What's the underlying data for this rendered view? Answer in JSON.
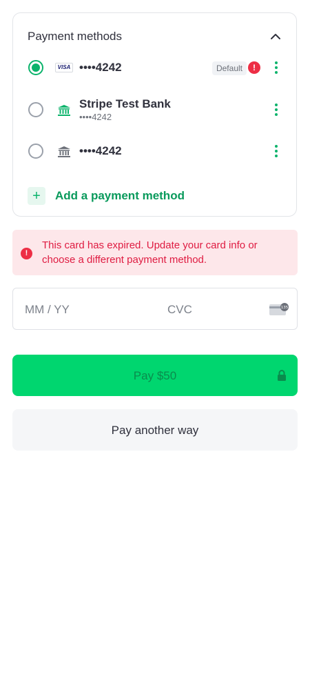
{
  "payment_methods": {
    "header": "Payment methods",
    "items": [
      {
        "brand": "VISA",
        "title": "••••4242",
        "selected": true,
        "badge": "Default",
        "error_icon": "!"
      },
      {
        "title": "Stripe Test Bank",
        "subtitle": "••••4242",
        "selected": false
      },
      {
        "title": "••••4242",
        "selected": false
      }
    ],
    "add_label": "Add a payment method",
    "add_symbol": "+"
  },
  "error_banner": {
    "icon": "!",
    "message": "This card has expired. Update your card info or choose a different payment method."
  },
  "card_input": {
    "expiry_placeholder": "MM / YY",
    "cvc_placeholder": "CVC",
    "cvc_icon_text": "135"
  },
  "pay_button": {
    "label": "Pay $50"
  },
  "alt_button": {
    "label": "Pay another way"
  },
  "colors": {
    "accent": "#00d66f",
    "accent_text": "#0a9a5c",
    "error": "#ed2e45",
    "error_bg": "#fde7ea"
  }
}
